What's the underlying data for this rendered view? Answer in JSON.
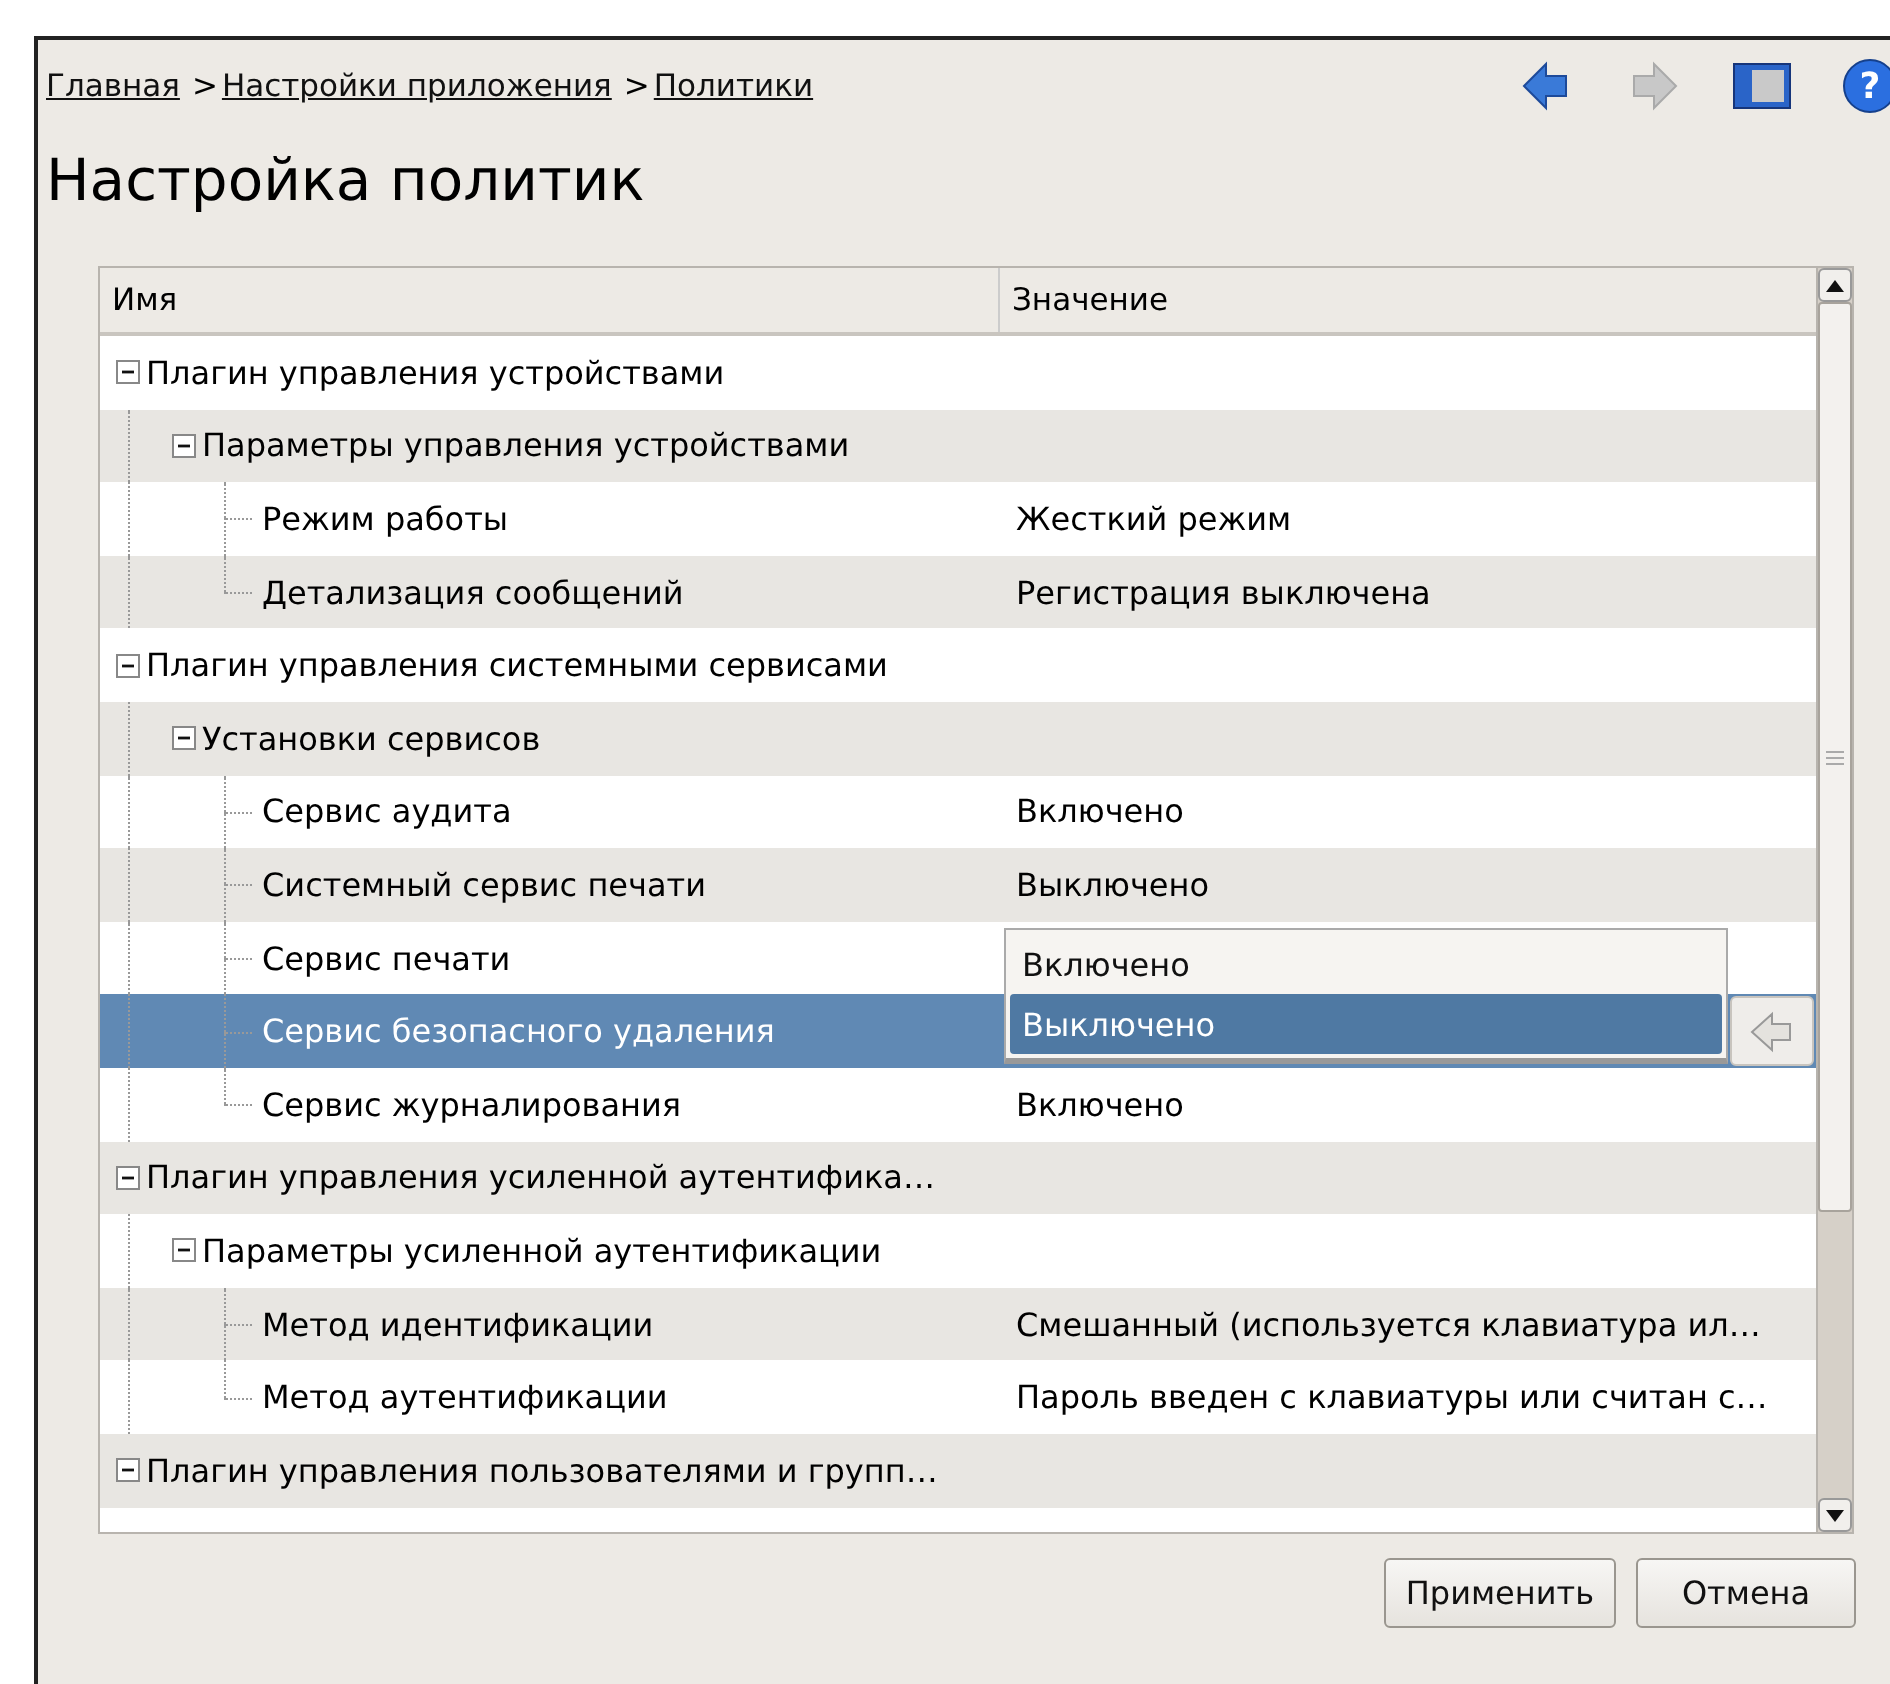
{
  "breadcrumb": {
    "separator": ">",
    "links": [
      {
        "label": "Главная"
      },
      {
        "label": "Настройки приложения"
      },
      {
        "label": "Политики"
      }
    ]
  },
  "toolbar": [
    {
      "kind": "back",
      "disabled": false
    },
    {
      "kind": "forward",
      "disabled": true
    },
    {
      "kind": "panel"
    },
    {
      "kind": "help",
      "glyph": "?"
    }
  ],
  "title": "Настройка политик",
  "table": {
    "columns": [
      "Имя",
      "Значение"
    ],
    "rows": [
      {
        "name": "Плагин управления устройствами",
        "expanded": true,
        "selected": false,
        "children": [
          {
            "name": "Параметры управления устройствами",
            "expanded": true,
            "selected": false,
            "children": [
              {
                "name": "Режим работы",
                "value": "Жесткий режим",
                "selected": false
              },
              {
                "name": "Детализация сообщений",
                "value": "Регистрация выключена",
                "selected": false
              }
            ]
          }
        ]
      },
      {
        "name": "Плагин управления системными сервисами",
        "expanded": true,
        "selected": false,
        "children": [
          {
            "name": "Установки сервисов",
            "expanded": true,
            "selected": false,
            "children": [
              {
                "name": "Сервис аудита",
                "value": "Включено",
                "selected": false
              },
              {
                "name": "Системный сервис печати",
                "value": "Выключено",
                "selected": false
              },
              {
                "name": "Сервис печати",
                "selected": false
              },
              {
                "name": "Сервис безопасного удаления",
                "selected": true,
                "editor": {
                  "options": [
                    {
                      "label": "Включено",
                      "selected": false
                    },
                    {
                      "label": "Выключено",
                      "selected": true
                    }
                  ]
                }
              },
              {
                "name": "Сервис журналирования",
                "value": "Включено",
                "selected": false
              }
            ]
          }
        ]
      },
      {
        "name": "Плагин управления усиленной аутентифика…",
        "expanded": true,
        "selected": false,
        "children": [
          {
            "name": "Параметры усиленной аутентификации",
            "expanded": true,
            "selected": false,
            "children": [
              {
                "name": "Метод идентификации",
                "value": "Смешанный (используется клавиатура ил…",
                "selected": false
              },
              {
                "name": "Метод аутентификации",
                "value": "Пароль введен с клавиатуры или считан с…",
                "selected": false
              }
            ]
          }
        ]
      },
      {
        "name": "Плагин управления пользователями и групп…",
        "expanded": true,
        "selected": false
      }
    ]
  },
  "buttons": [
    {
      "label": "Применить"
    },
    {
      "label": "Отмена"
    }
  ]
}
